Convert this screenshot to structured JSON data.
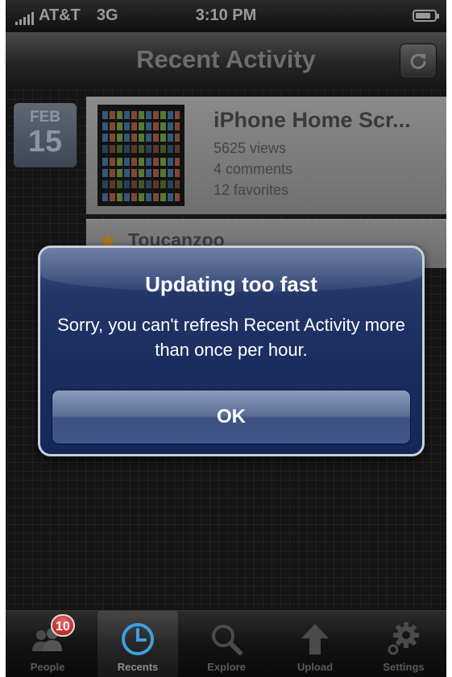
{
  "status_bar": {
    "carrier": "AT&T",
    "network": "3G",
    "time": "3:10 PM"
  },
  "nav_bar": {
    "title": "Recent Activity",
    "refresh_icon": "refresh-icon"
  },
  "activity": {
    "date": {
      "month": "FEB",
      "day": "15"
    },
    "photo": {
      "title": "iPhone Home Scr...",
      "views": "5625 views",
      "comments": "4 comments",
      "favorites": "12 favorites"
    },
    "next_item": {
      "user": "Toucanzoo",
      "icon": "star-icon"
    }
  },
  "alert": {
    "title": "Updating too fast",
    "message": "Sorry, you can't refresh Recent Activity more than once per hour.",
    "ok_label": "OK"
  },
  "tab_bar": {
    "tabs": [
      {
        "label": "People",
        "icon": "people-icon",
        "badge": "10",
        "selected": false
      },
      {
        "label": "Recents",
        "icon": "clock-icon",
        "selected": true
      },
      {
        "label": "Explore",
        "icon": "magnifier-icon",
        "selected": false
      },
      {
        "label": "Upload",
        "icon": "upload-arrow-icon",
        "selected": false
      },
      {
        "label": "Settings",
        "icon": "gear-icon",
        "selected": false
      }
    ]
  },
  "colors": {
    "alert_blue": "#1a2c5e",
    "accent_blue": "#3f9fe0",
    "badge_red": "#c41a1a"
  }
}
